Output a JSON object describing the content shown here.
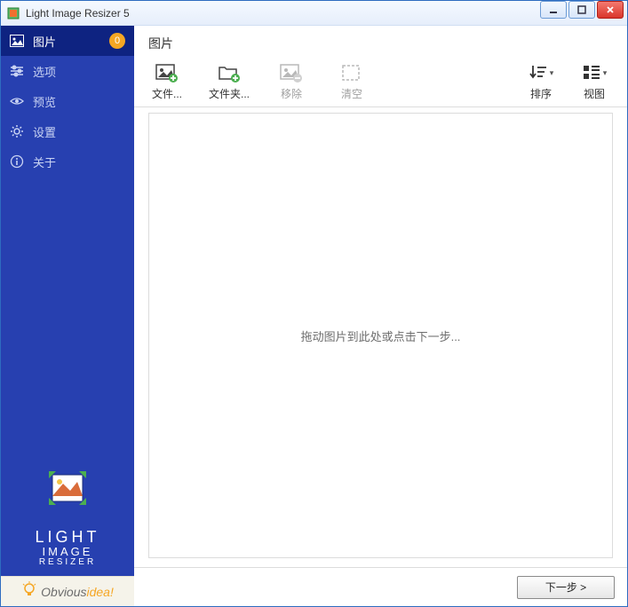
{
  "window": {
    "title": "Light Image Resizer 5"
  },
  "sidebar": {
    "items": [
      {
        "label": "图片",
        "badge": "0",
        "icon": "image-icon"
      },
      {
        "label": "选项",
        "icon": "sliders-icon"
      },
      {
        "label": "预览",
        "icon": "eye-icon"
      },
      {
        "label": "设置",
        "icon": "gear-icon"
      },
      {
        "label": "关于",
        "icon": "info-icon"
      }
    ],
    "brand_line1": "LIGHT",
    "brand_line2": "IMAGE",
    "brand_line3": "RESIZER",
    "footer_brand_main": "Obvious",
    "footer_brand_accent": "idea!"
  },
  "main": {
    "header": "图片",
    "toolbar": {
      "add_file": "文件...",
      "add_folder": "文件夹...",
      "remove": "移除",
      "clear": "清空",
      "sort": "排序",
      "view": "视图"
    },
    "drop_hint": "拖动图片到此处或点击下一步...",
    "next_button": "下一步 >"
  }
}
